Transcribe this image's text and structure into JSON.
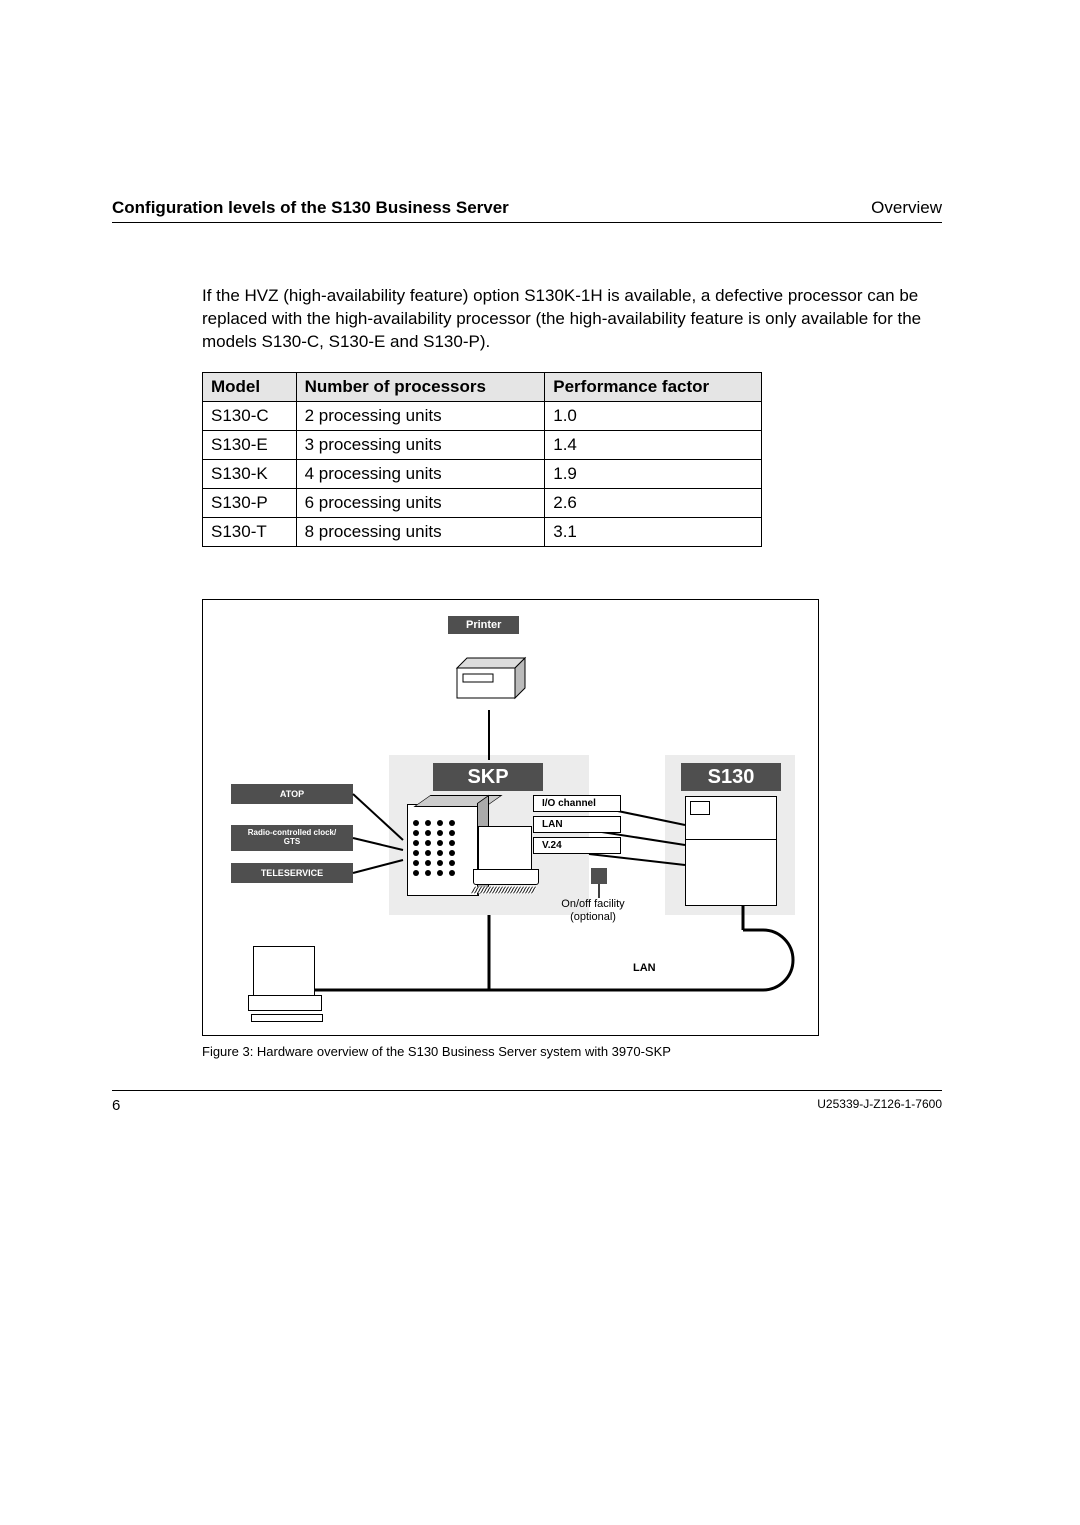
{
  "header": {
    "left": "Configuration levels of the S130 Business Server",
    "right": "Overview"
  },
  "paragraph": "If the HVZ (high-availability feature) option S130K-1H is available, a defective processor can be replaced with the high-availability processor (the high-availability feature is only available for the models S130-C, S130-E and S130-P).",
  "table": {
    "headers": [
      "Model",
      "Number of processors",
      "Performance factor"
    ],
    "rows": [
      [
        "S130-C",
        "2 processing units",
        "1.0"
      ],
      [
        "S130-E",
        "3 processing units",
        "1.4"
      ],
      [
        "S130-K",
        "4 processing units",
        "1.9"
      ],
      [
        "S130-P",
        "6 processing units",
        "2.6"
      ],
      [
        "S130-T",
        "8 processing units",
        "3.1"
      ]
    ]
  },
  "figure": {
    "printer": "Printer",
    "skp": "SKP",
    "s130": "S130",
    "atop": "ATOP",
    "radio": "Radio-controlled clock/\nGTS",
    "tele": "TELESERVICE",
    "conns": {
      "io": "I/O channel",
      "lan": "LAN",
      "v24": "V.24"
    },
    "onoff_l1": "On/off facility",
    "onoff_l2": "(optional)",
    "lan": "LAN",
    "caption": "Figure 3: Hardware overview of the S130 Business Server system with 3970-SKP"
  },
  "footer": {
    "page": "6",
    "doc": "U25339-J-Z126-1-7600"
  }
}
